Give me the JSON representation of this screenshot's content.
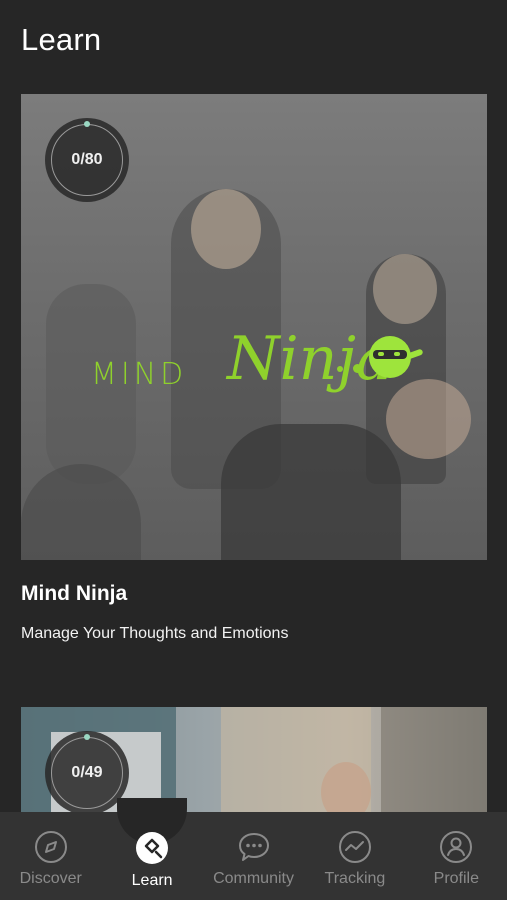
{
  "header": {
    "title": "Learn"
  },
  "cards": [
    {
      "progress": "0/80",
      "logo": {
        "text": "MIND",
        "script": "Ninja"
      },
      "title": "Mind Ninja",
      "subtitle": "Manage Your Thoughts  and Emotions"
    },
    {
      "progress": "0/49"
    }
  ],
  "tabs": [
    {
      "label": "Discover",
      "icon": "compass-icon"
    },
    {
      "label": "Learn",
      "icon": "learn-icon",
      "active": true
    },
    {
      "label": "Community",
      "icon": "chat-bubble-icon"
    },
    {
      "label": "Tracking",
      "icon": "chart-trend-icon"
    },
    {
      "label": "Profile",
      "icon": "person-icon"
    }
  ],
  "colors": {
    "background": "#262626",
    "tabbar": "#333333",
    "brand_green": "#8fd12c",
    "inactive_tab": "#8a8a8a"
  }
}
